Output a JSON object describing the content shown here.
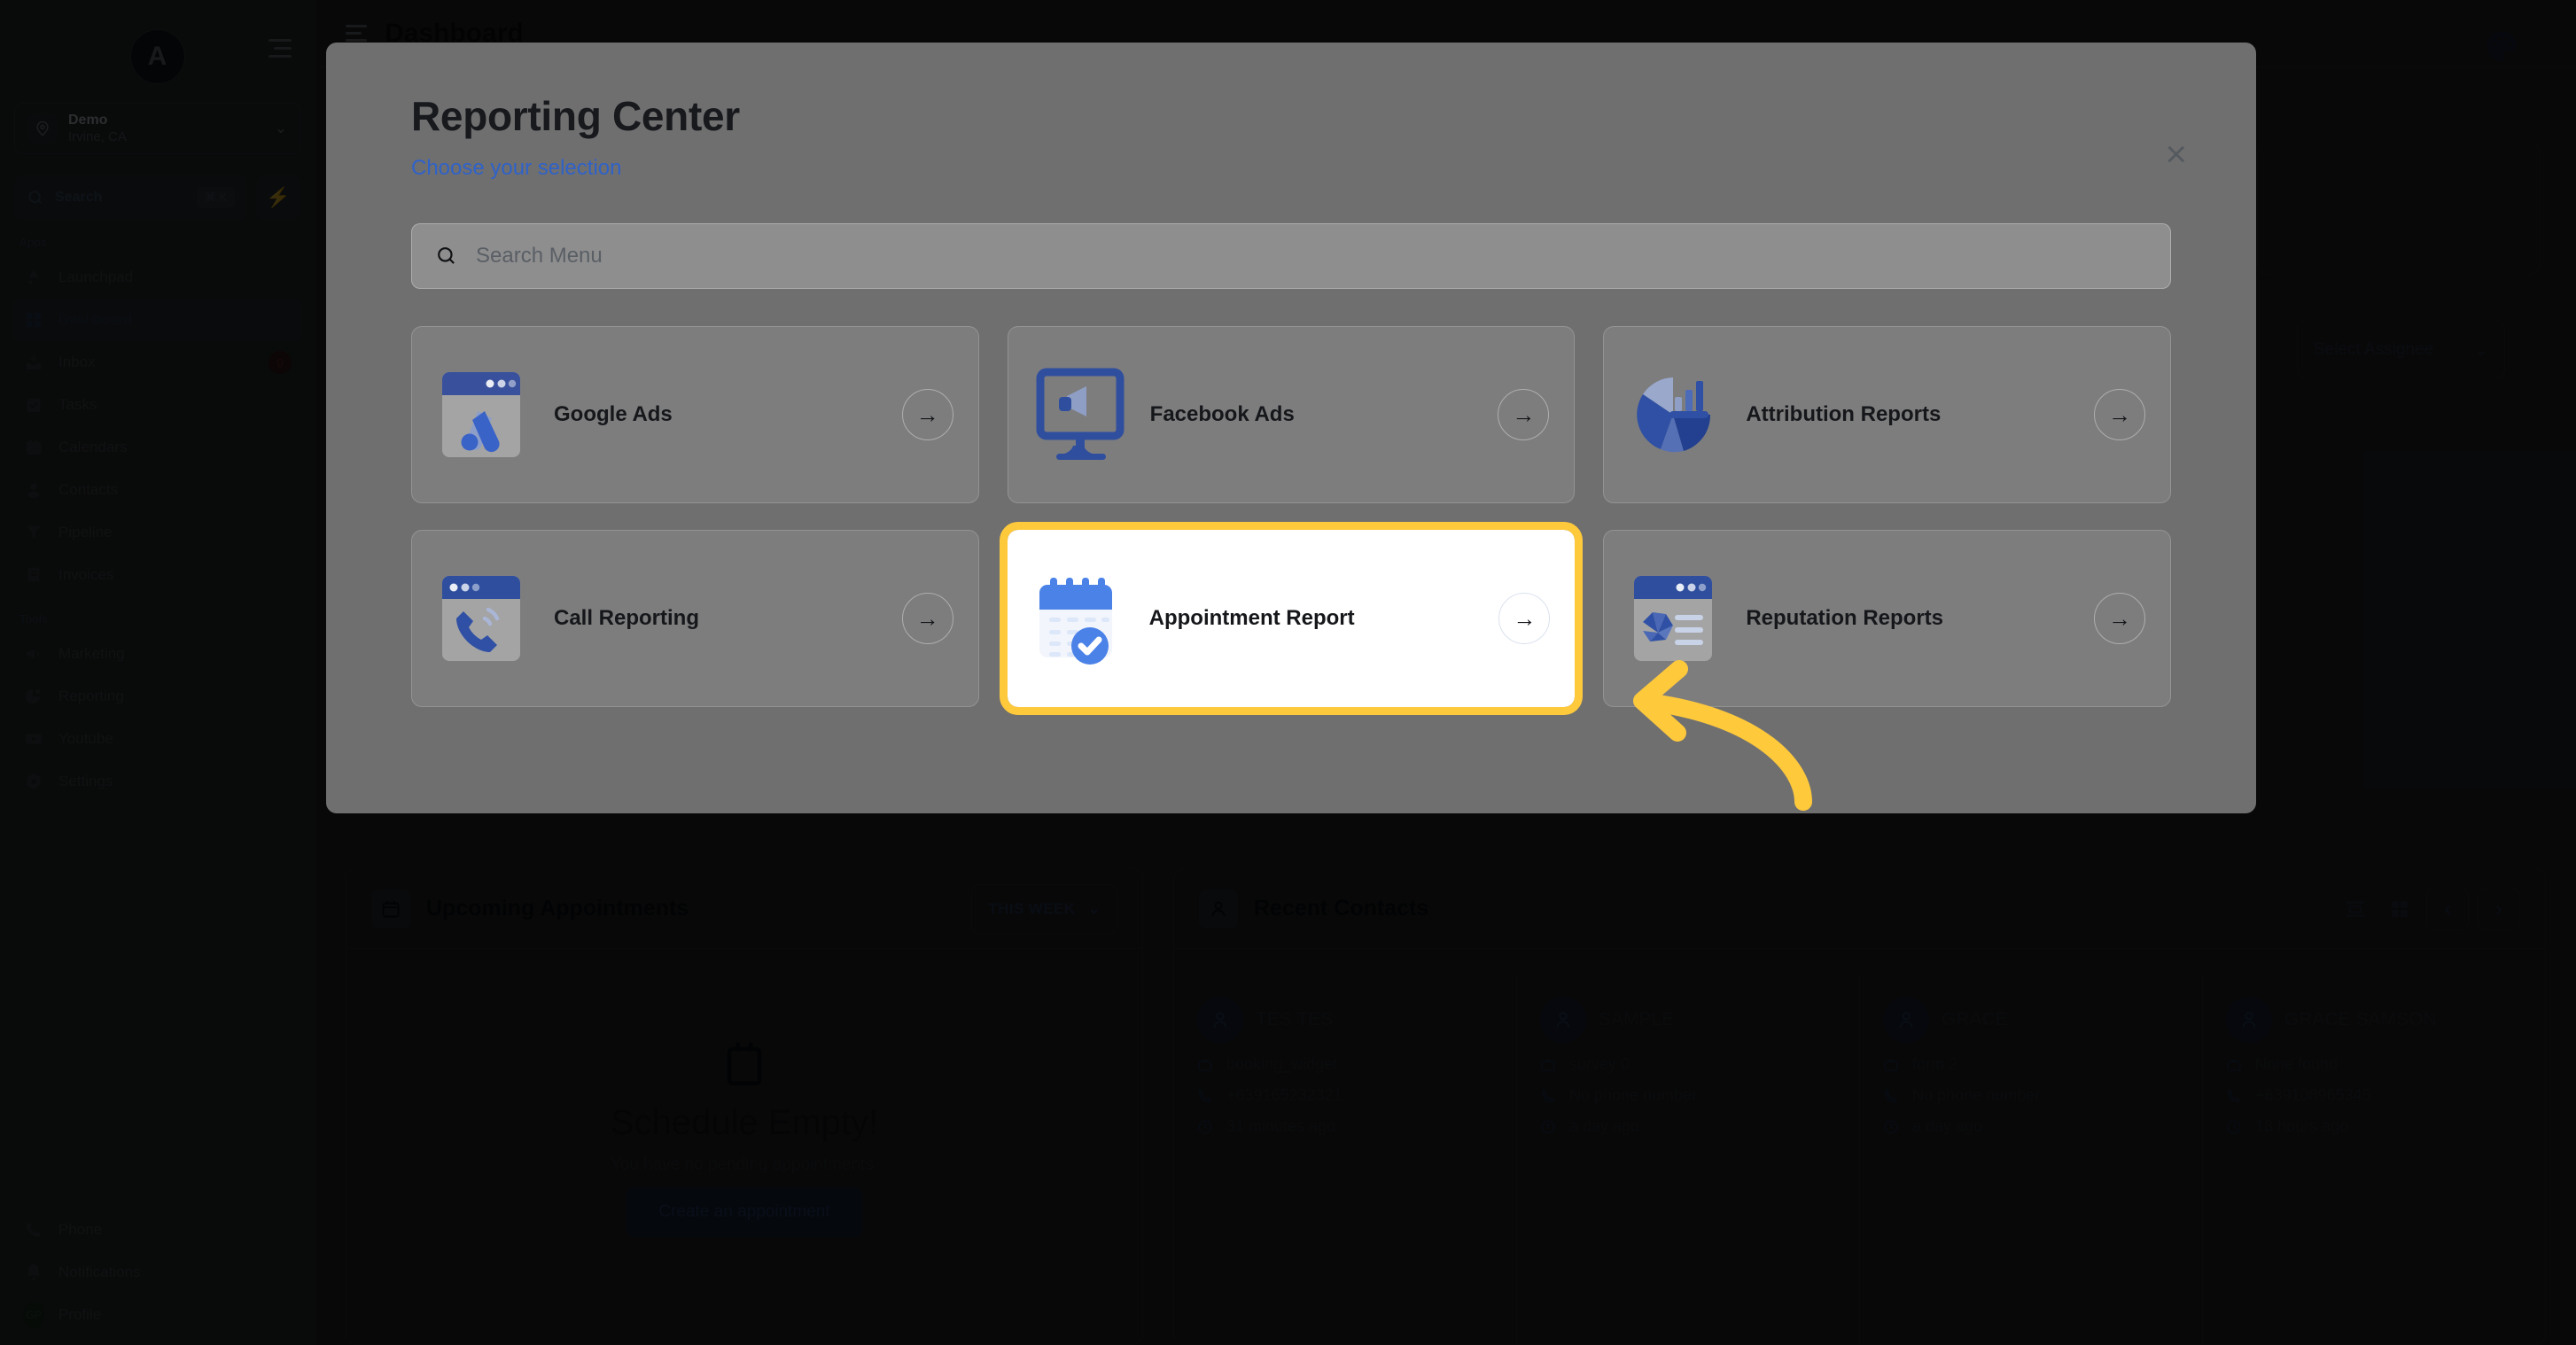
{
  "app": {
    "page_title": "Dashboard",
    "sidebar": {
      "logo_letter": "A",
      "location": {
        "name": "Demo",
        "sub": "Irvine, CA"
      },
      "search": {
        "label": "Search",
        "shortcut": "⌘ K"
      },
      "groups": [
        {
          "label": "Apps",
          "items": [
            {
              "label": "Launchpad",
              "icon": "rocket-icon",
              "badge": ""
            },
            {
              "label": "Dashboard",
              "icon": "grid-icon",
              "badge": "",
              "active": true
            },
            {
              "label": "Inbox",
              "icon": "inbox-icon",
              "badge": "0"
            },
            {
              "label": "Tasks",
              "icon": "tasks-icon",
              "badge": ""
            },
            {
              "label": "Calendars",
              "icon": "calendar-icon",
              "badge": ""
            },
            {
              "label": "Contacts",
              "icon": "contacts-icon",
              "badge": ""
            },
            {
              "label": "Pipeline",
              "icon": "funnel-icon",
              "badge": ""
            },
            {
              "label": "Invoices",
              "icon": "invoice-icon",
              "badge": ""
            }
          ]
        },
        {
          "label": "Tools",
          "items": [
            {
              "label": "Marketing",
              "icon": "megaphone-icon",
              "badge": ""
            },
            {
              "label": "Reporting",
              "icon": "pie-chart-icon",
              "badge": ""
            },
            {
              "label": "Youtube",
              "icon": "youtube-icon",
              "badge": ""
            },
            {
              "label": "Settings",
              "icon": "gear-icon",
              "badge": ""
            }
          ]
        }
      ],
      "footer_items": [
        {
          "label": "Phone",
          "icon": "phone-icon"
        },
        {
          "label": "Notifications",
          "icon": "bell-icon"
        },
        {
          "label": "Profile",
          "icon": "avatar",
          "initials": "GP"
        }
      ]
    },
    "assignee_select": {
      "value": "Select Assignee"
    },
    "appointments_panel": {
      "title": "Upcoming Appointments",
      "range": "THIS WEEK",
      "empty_title": "Schedule Empty!",
      "empty_sub": "You have no pending appointments.",
      "cta": "Create an appointment"
    },
    "contacts_panel": {
      "title": "Recent Contacts",
      "contacts": [
        {
          "name": "TES TES",
          "source": "booking_widget",
          "phone": "+639165232321",
          "time": "31 minutes ago"
        },
        {
          "name": "SAMPLE",
          "source": "survey 0",
          "phone": "No phone number",
          "time": "a day ago"
        },
        {
          "name": "GRACE",
          "source": "form 2",
          "phone": "No phone number",
          "time": "a day ago"
        },
        {
          "name": "GRACE SAMSON",
          "source": "None found",
          "phone": "+639108965345",
          "time": "18 hours ago"
        }
      ]
    }
  },
  "modal": {
    "title": "Reporting Center",
    "subtitle": "Choose your selection",
    "close_label": "×",
    "search": {
      "placeholder": "Search Menu",
      "value": ""
    },
    "cards": [
      {
        "label": "Google Ads",
        "icon": "google-ads-icon",
        "highlighted": false
      },
      {
        "label": "Facebook Ads",
        "icon": "facebook-ads-icon",
        "highlighted": false
      },
      {
        "label": "Attribution Reports",
        "icon": "attribution-reports-icon",
        "highlighted": false
      },
      {
        "label": "Call Reporting",
        "icon": "call-reporting-icon",
        "highlighted": false
      },
      {
        "label": "Appointment Report",
        "icon": "appointment-report-icon",
        "highlighted": true
      },
      {
        "label": "Reputation Reports",
        "icon": "reputation-reports-icon",
        "highlighted": false
      }
    ]
  },
  "annotation": {
    "arrow_color": "#FFC93C",
    "highlight_color": "#FFC93C"
  }
}
